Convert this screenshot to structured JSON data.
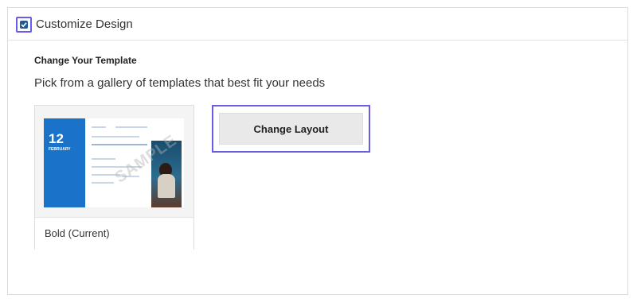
{
  "panel": {
    "title": "Customize Design",
    "checkbox_checked": true
  },
  "section": {
    "title": "Change Your Template",
    "description": "Pick from a gallery of templates that best fit your needs"
  },
  "template_card": {
    "label": "Bold (Current)",
    "thumbnail": {
      "day": "12",
      "month": "FEBRUARY",
      "watermark": "SAMPLE"
    }
  },
  "actions": {
    "change_layout_label": "Change Layout"
  },
  "colors": {
    "focus_outline": "#6b5ce7",
    "checkbox": "#1f5d8f",
    "thumbnail_blue": "#1a73c9"
  }
}
